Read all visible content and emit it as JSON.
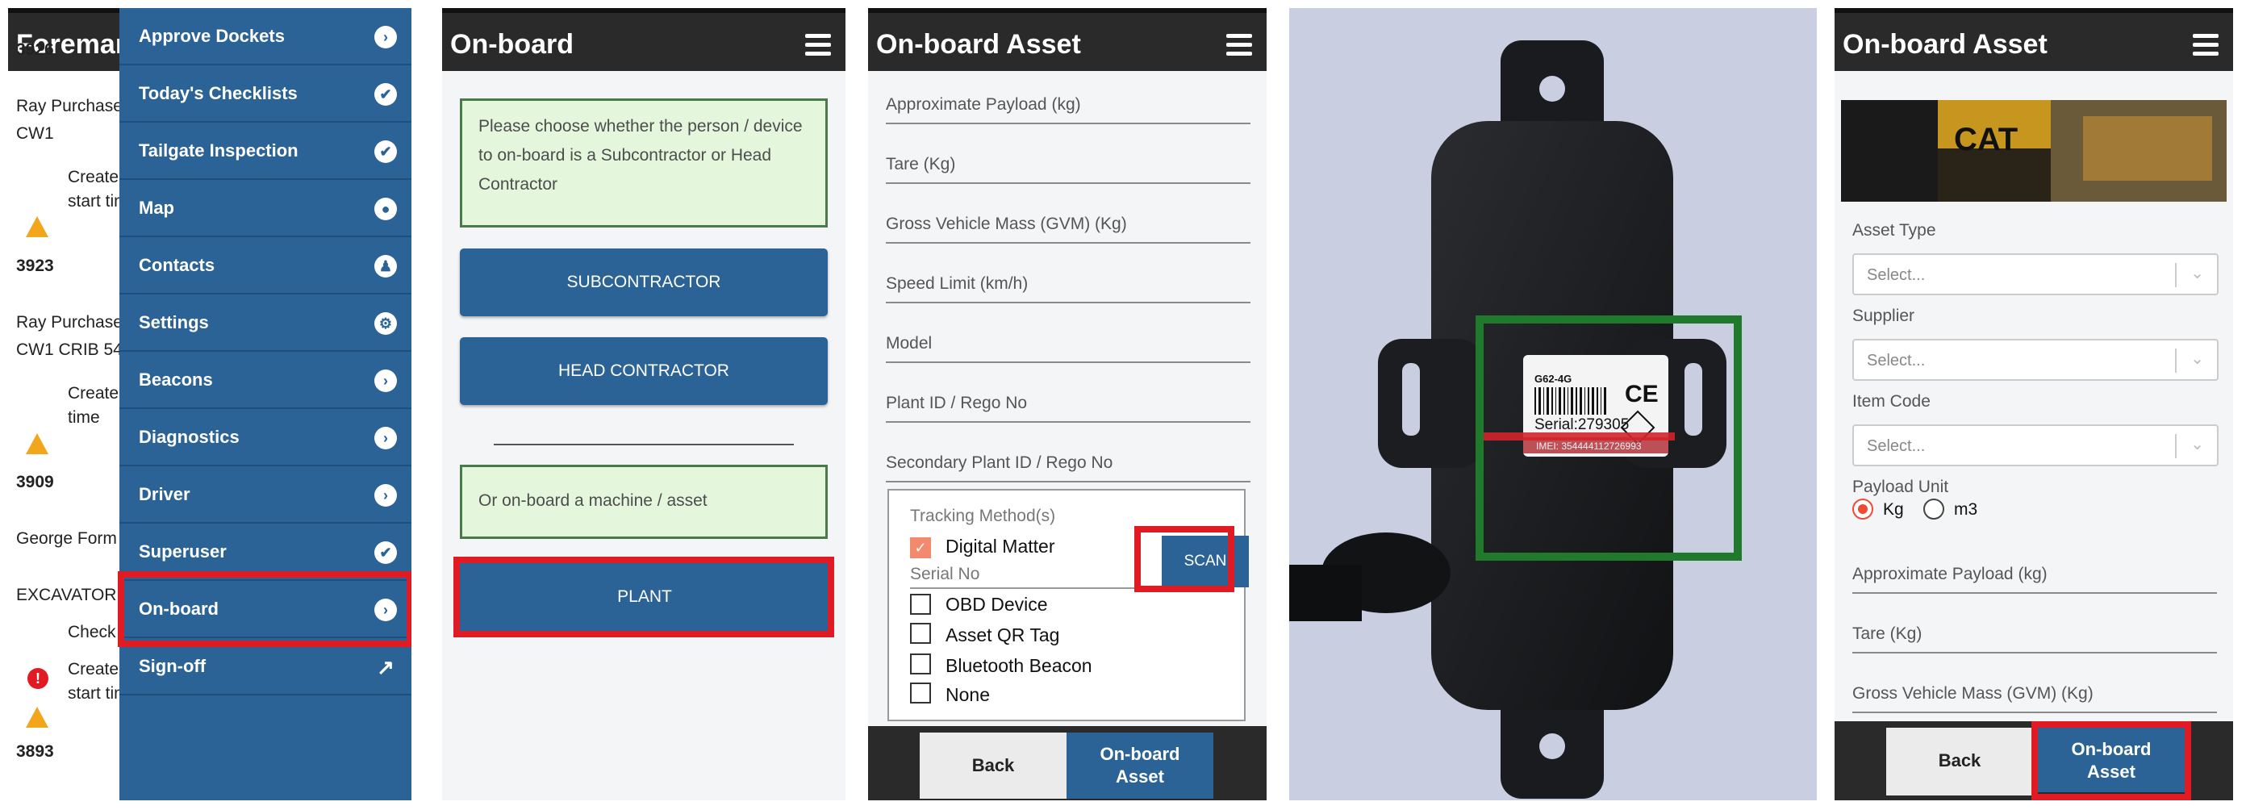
{
  "panel1": {
    "header_title": "Foreman",
    "background": {
      "items": [
        {
          "text": "3926",
          "bold": true
        },
        {
          "text": "Ray Purchase",
          "bold": false
        },
        {
          "text": "CW1",
          "bold": false
        },
        {
          "text": "Create",
          "bold": false
        },
        {
          "text": "start tim",
          "bold": false
        },
        {
          "text": "3923",
          "bold": true
        },
        {
          "text": "Ray Purchase",
          "bold": false
        },
        {
          "text": "CW1 CRIB 54",
          "bold": false
        },
        {
          "text": "Create",
          "bold": false
        },
        {
          "text": "time",
          "bold": false
        },
        {
          "text": "3909",
          "bold": true
        },
        {
          "text": "George Form",
          "bold": false
        },
        {
          "text": "EXCAVATOR",
          "bold": false
        },
        {
          "text": "Check",
          "bold": false
        },
        {
          "text": "Create",
          "bold": false
        },
        {
          "text": "start tim",
          "bold": false
        },
        {
          "text": "3893",
          "bold": true
        }
      ]
    },
    "menu": [
      {
        "label": "Approve Dockets",
        "icon": "chevron-right-icon",
        "glyph": "›"
      },
      {
        "label": "Today's Checklists",
        "icon": "check-icon",
        "glyph": "✔"
      },
      {
        "label": "Tailgate Inspection",
        "icon": "check-icon",
        "glyph": "✔"
      },
      {
        "label": "Map",
        "icon": "map-pin-icon",
        "glyph": "●"
      },
      {
        "label": "Contacts",
        "icon": "user-icon",
        "glyph": "♟"
      },
      {
        "label": "Settings",
        "icon": "gear-icon",
        "glyph": "⚙"
      },
      {
        "label": "Beacons",
        "icon": "chevron-right-icon",
        "glyph": "›"
      },
      {
        "label": "Diagnostics",
        "icon": "chevron-right-icon",
        "glyph": "›"
      },
      {
        "label": "Driver",
        "icon": "chevron-right-icon",
        "glyph": "›"
      },
      {
        "label": "Superuser",
        "icon": "check-icon",
        "glyph": "✔"
      },
      {
        "label": "On-board",
        "icon": "chevron-right-icon",
        "glyph": "›"
      },
      {
        "label": "Sign-off",
        "icon": "external-link-icon",
        "glyph": "↗"
      }
    ]
  },
  "panel2": {
    "header_title": "On-board",
    "instruction": "Please choose whether the person / device to on-board is a Subcontractor or Head Contractor",
    "subcontractor_button": "SUBCONTRACTOR",
    "head_contractor_button": "HEAD CONTRACTOR",
    "asset_note": "Or on-board a machine / asset",
    "plant_button": "PLANT"
  },
  "panel3": {
    "header_title": "On-board Asset",
    "fields": [
      "Approximate Payload (kg)",
      "Tare (Kg)",
      "Gross Vehicle Mass (GVM) (Kg)",
      "Speed Limit (km/h)",
      "Model",
      "Plant ID / Rego No",
      "Secondary Plant ID / Rego No"
    ],
    "tracking": {
      "title": "Tracking Method(s)",
      "digital_matter": "Digital Matter",
      "scan_button": "SCAN",
      "serial_no": "Serial No",
      "options": [
        "OBD Device",
        "Asset QR Tag",
        "Bluetooth Beacon",
        "None"
      ]
    },
    "back_button": "Back",
    "onboard_button": "On-board Asset"
  },
  "panel4": {
    "device_label": {
      "model": "G62-4G",
      "serial": "Serial:279305",
      "imei": "IMEI: 354444112726993",
      "mark": "CE"
    }
  },
  "panel5": {
    "header_title": "On-board Asset",
    "photo_brand": "CAT",
    "asset_type_label": "Asset Type",
    "asset_type_value": "Select...",
    "supplier_label": "Supplier",
    "supplier_value": "Select...",
    "item_code_label": "Item Code",
    "item_code_value": "Select...",
    "payload_unit_label": "Payload Unit",
    "payload_unit_options": [
      "Kg",
      "m3"
    ],
    "fields": [
      "Approximate Payload (kg)",
      "Tare (Kg)",
      "Gross Vehicle Mass (GVM) (Kg)"
    ],
    "back_button": "Back",
    "onboard_button": "On-board Asset"
  }
}
